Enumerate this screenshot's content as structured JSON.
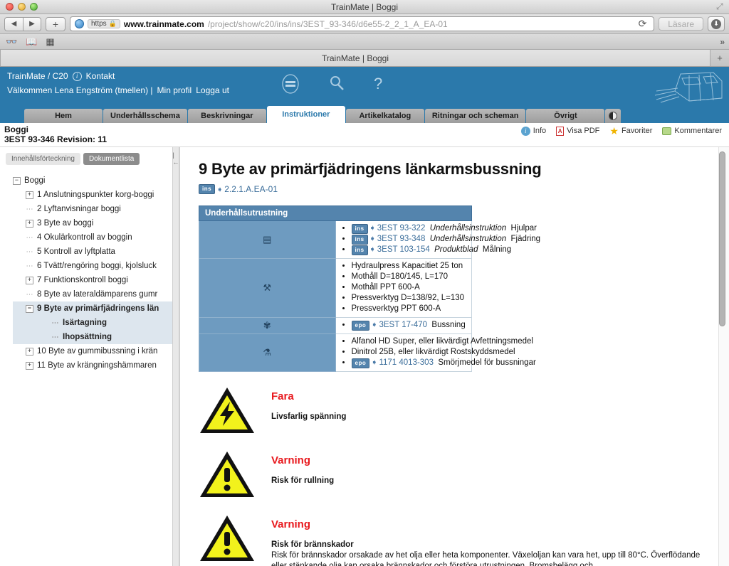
{
  "browser": {
    "window_title": "TrainMate | Boggi",
    "back_label": "◀",
    "forward_label": "▶",
    "add_label": "+",
    "https_label": "https",
    "lock_icon": "🔒",
    "url_host": "www.trainmate.com",
    "url_path": "/project/show/c20/ins/ins/3EST_93-346/d6e55-2_2_1_A_EA-01",
    "reload_label": "⟳",
    "reader_label": "Läsare",
    "download_label": "⬇",
    "bookmarks": [
      "reader-glasses-icon",
      "book-icon",
      "grid-icon"
    ],
    "chevrons_label": "»",
    "tab_title": "TrainMate | Boggi",
    "tab_plus_label": "+",
    "resize_label": "⤢"
  },
  "appheader": {
    "breadcrumb": "TrainMate / C20",
    "info_label": "i",
    "kontakt": "Kontakt",
    "welcome": "Välkommen Lena Engström (tmellen) |",
    "profile": "Min profil",
    "logout": "Logga ut",
    "accent_color": "#2b79ab"
  },
  "nav": {
    "tabs": [
      {
        "label": "Hem",
        "active": false
      },
      {
        "label": "Underhållsschema",
        "active": false
      },
      {
        "label": "Beskrivningar",
        "active": false
      },
      {
        "label": "Instruktioner",
        "active": true
      },
      {
        "label": "Artikelkatalog",
        "active": false
      },
      {
        "label": "Ritningar och scheman",
        "active": false
      },
      {
        "label": "Övrigt",
        "active": false
      }
    ]
  },
  "docbar": {
    "title": "Boggi",
    "subtitle": "3EST 93-346 Revision: 11",
    "tools": [
      {
        "label": "Info",
        "icon": "info-icon"
      },
      {
        "label": "Visa PDF",
        "icon": "pdf-icon"
      },
      {
        "label": "Favoriter",
        "icon": "star-icon"
      },
      {
        "label": "Kommentarer",
        "icon": "comment-icon"
      }
    ]
  },
  "sidebar": {
    "tabs": [
      {
        "label": "Innehållsförteckning",
        "selected": false
      },
      {
        "label": "Dokumentlista",
        "selected": true
      }
    ],
    "collapse_icon": "|←",
    "tree": [
      {
        "label": "Boggi",
        "level": 0,
        "toggle": "minus",
        "selected": false,
        "bold": false
      },
      {
        "label": "1 Anslutningspunkter korg-boggi",
        "level": 1,
        "toggle": "plus",
        "selected": false,
        "bold": false
      },
      {
        "label": "2 Lyftanvisningar boggi",
        "level": 1,
        "toggle": "leaf",
        "selected": false,
        "bold": false
      },
      {
        "label": "3 Byte av boggi",
        "level": 1,
        "toggle": "plus",
        "selected": false,
        "bold": false
      },
      {
        "label": "4 Okulärkontroll av boggin",
        "level": 1,
        "toggle": "leaf",
        "selected": false,
        "bold": false
      },
      {
        "label": "5 Kontroll av lyftplatta",
        "level": 1,
        "toggle": "leaf",
        "selected": false,
        "bold": false
      },
      {
        "label": "6 Tvätt/rengöring boggi, kjolsluck",
        "level": 1,
        "toggle": "leaf",
        "selected": false,
        "bold": false
      },
      {
        "label": "7 Funktionskontroll boggi",
        "level": 1,
        "toggle": "plus",
        "selected": false,
        "bold": false
      },
      {
        "label": "8 Byte av lateraldämparens gumr",
        "level": 1,
        "toggle": "leaf",
        "selected": false,
        "bold": false
      },
      {
        "label": "9 Byte av primärfjädringens län",
        "level": 1,
        "toggle": "minus",
        "selected": true,
        "bold": true
      },
      {
        "label": "Isärtagning",
        "level": 2,
        "toggle": "leaf",
        "selected": true,
        "bold": true
      },
      {
        "label": "Ihopsättning",
        "level": 2,
        "toggle": "leaf",
        "selected": true,
        "bold": true
      },
      {
        "label": "10 Byte av gummibussning i krän",
        "level": 1,
        "toggle": "plus",
        "selected": false,
        "bold": false
      },
      {
        "label": "11 Byte av krängningshämmaren",
        "level": 1,
        "toggle": "plus",
        "selected": false,
        "bold": false
      }
    ]
  },
  "content": {
    "heading": "9 Byte av primärfjädringens länkarmsbussning",
    "id_chip": "ins",
    "id_arrow": "➧",
    "id_link": "2.2.1.A.EA-01",
    "table": {
      "header": "Underhållsutrustning",
      "rows": [
        {
          "icon": "document-icon",
          "items": [
            {
              "chip": "ins",
              "code": "3EST 93-322",
              "italic": "Underhållsinstruktion",
              "rest": "Hjulpar"
            },
            {
              "chip": "ins",
              "code": "3EST 93-348",
              "italic": "Underhållsinstruktion",
              "rest": "Fjädring"
            },
            {
              "chip": "ins",
              "code": "3EST 103-154",
              "italic": "Produktblad",
              "rest": "Målning"
            }
          ]
        },
        {
          "icon": "wrench-icon",
          "items": [
            {
              "chip": "",
              "code": "",
              "italic": "",
              "rest": "Hydraulpress Kapacitiet 25 ton"
            },
            {
              "chip": "",
              "code": "",
              "italic": "",
              "rest": "Mothåll D=180/145, L=170"
            },
            {
              "chip": "",
              "code": "",
              "italic": "",
              "rest": "Mothåll PPT 600-A"
            },
            {
              "chip": "",
              "code": "",
              "italic": "",
              "rest": "Pressverktyg D=138/92, L=130"
            },
            {
              "chip": "",
              "code": "",
              "italic": "",
              "rest": "Pressverktyg PPT 600-A"
            }
          ]
        },
        {
          "icon": "gear-icon",
          "items": [
            {
              "chip": "epo",
              "code": "3EST 17-470",
              "italic": "",
              "rest": "Bussning"
            }
          ]
        },
        {
          "icon": "oilcan-icon",
          "items": [
            {
              "chip": "",
              "code": "",
              "italic": "",
              "rest": "Alfanol HD Super, eller likvärdigt Avfettningsmedel"
            },
            {
              "chip": "",
              "code": "",
              "italic": "",
              "rest": "Dinitrol 25B, eller likvärdigt Rostskyddsmedel"
            },
            {
              "chip": "epo",
              "code": "1171 4013-303",
              "italic": "",
              "rest": "Smörjmedel för bussningar"
            }
          ]
        }
      ]
    },
    "warnings": [
      {
        "sign": "electric",
        "title": "Fara",
        "subtitle": "Livsfarlig spänning",
        "body": ""
      },
      {
        "sign": "exclamation",
        "title": "Varning",
        "subtitle": "Risk för rullning",
        "body": ""
      },
      {
        "sign": "exclamation",
        "title": "Varning",
        "subtitle": "Risk för brännskador",
        "body": "Risk för brännskador orsakade av het olja eller heta komponenter. Växeloljan kan vara het, upp till 80°C. Överflödande eller stänkande olja kan orsaka brännskador och förstöra utrustningen. Bromsbelägg och"
      }
    ],
    "warning_color": "#e8191e"
  }
}
